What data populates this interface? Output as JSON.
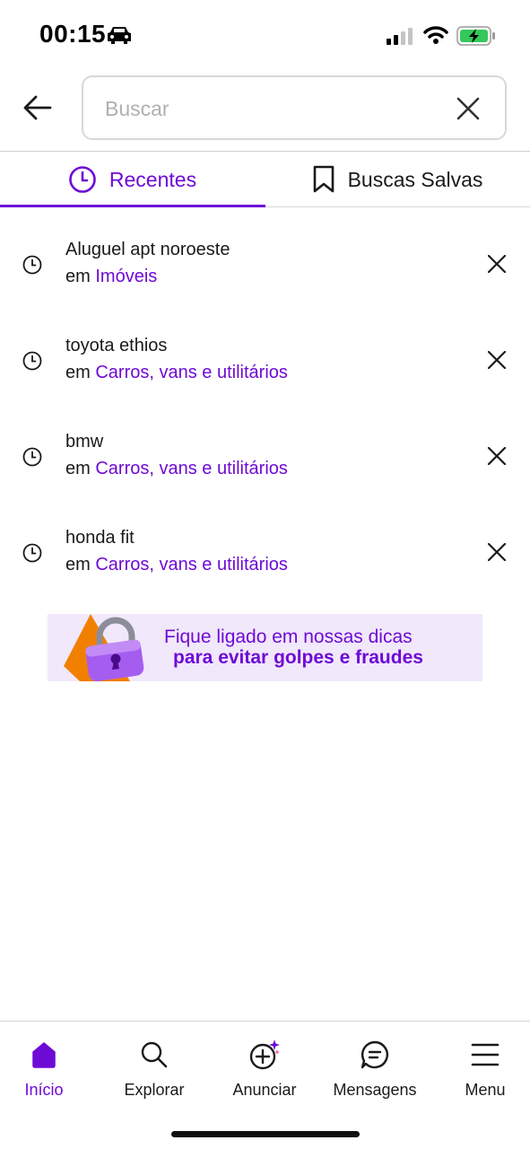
{
  "status_bar": {
    "time": "00:15"
  },
  "search": {
    "placeholder": "Buscar",
    "value": ""
  },
  "tabs": [
    {
      "label": "Recentes",
      "icon": "clock-icon",
      "active": true
    },
    {
      "label": "Buscas Salvas",
      "icon": "bookmark-icon",
      "active": false
    }
  ],
  "recent_searches": [
    {
      "query": "Aluguel apt noroeste",
      "prefix": "em",
      "category": "Imóveis"
    },
    {
      "query": "toyota ethios",
      "prefix": "em",
      "category": "Carros, vans e utilitários"
    },
    {
      "query": "bmw",
      "prefix": "em",
      "category": "Carros, vans e utilitários"
    },
    {
      "query": "honda fit",
      "prefix": "em",
      "category": "Carros, vans e utilitários"
    }
  ],
  "banner": {
    "line1": "Fique ligado em nossas dicas",
    "line2": "para evitar golpes e fraudes"
  },
  "bottom_nav": [
    {
      "label": "Início",
      "icon": "home-icon",
      "active": true
    },
    {
      "label": "Explorar",
      "icon": "search-icon",
      "active": false
    },
    {
      "label": "Anunciar",
      "icon": "add-sparkle-icon",
      "active": false
    },
    {
      "label": "Mensagens",
      "icon": "chat-icon",
      "active": false
    },
    {
      "label": "Menu",
      "icon": "menu-icon",
      "active": false
    }
  ],
  "colors": {
    "accent": "#6e0ad6",
    "text": "#1a1a1a",
    "divider": "#d8d8d8",
    "banner_bg": "#f1e8fb",
    "banner_orange": "#f28000"
  }
}
